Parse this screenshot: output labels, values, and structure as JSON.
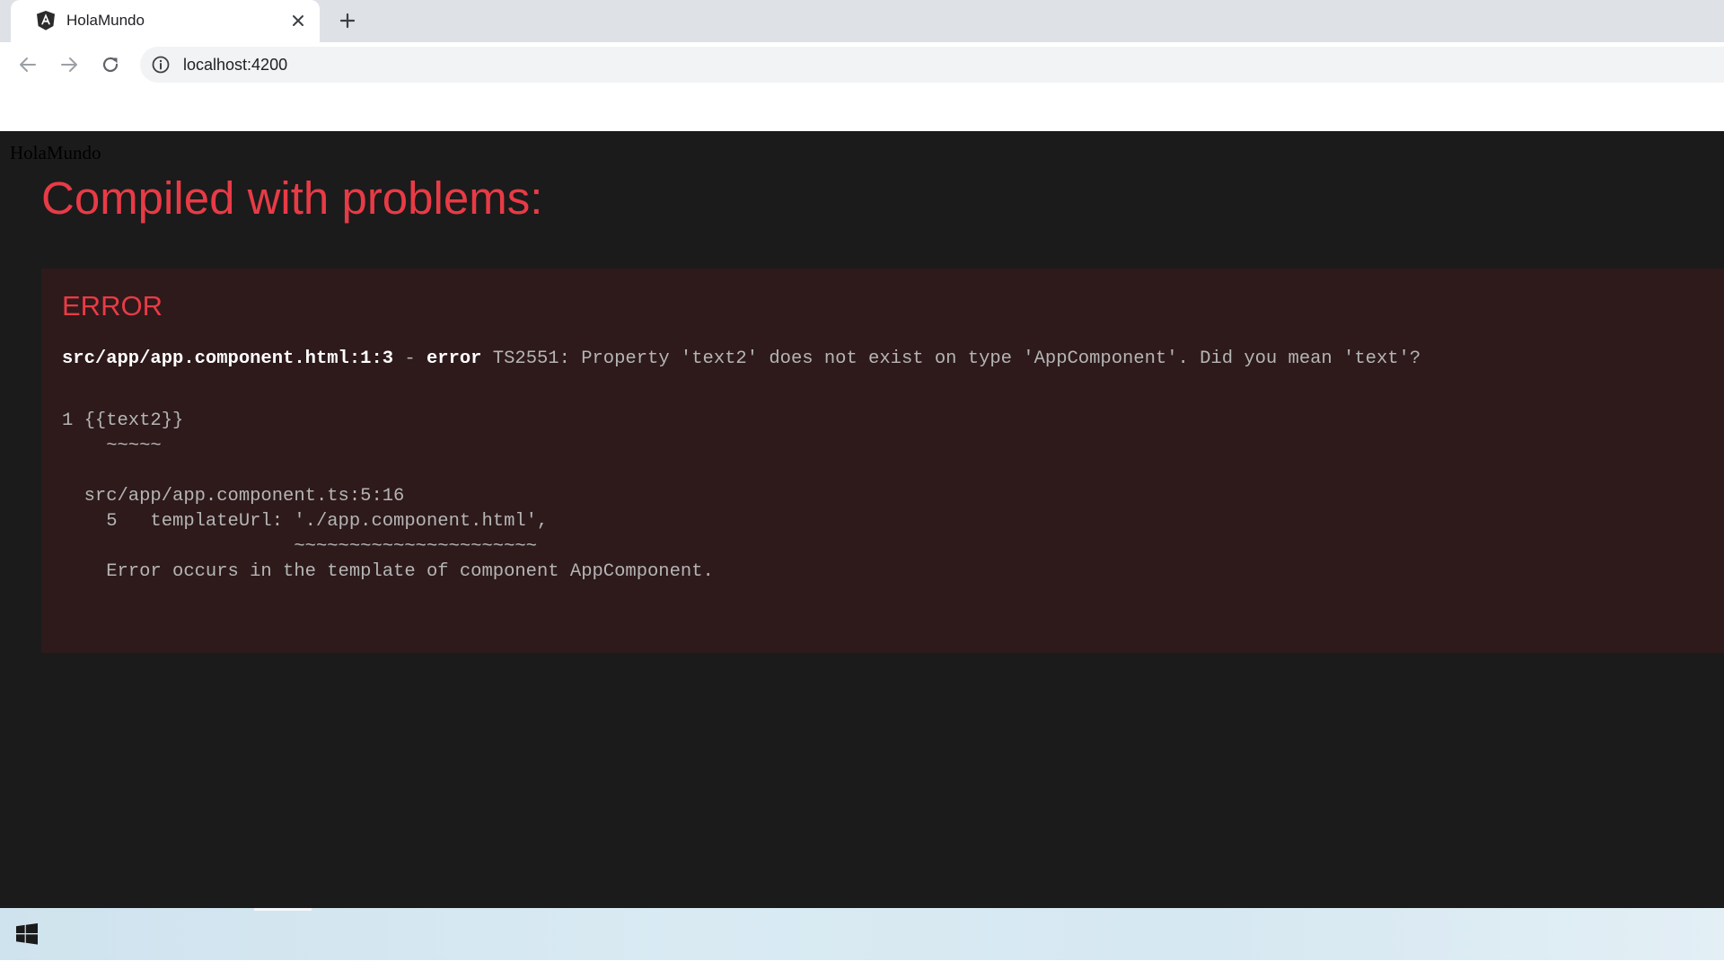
{
  "browser": {
    "tab": {
      "title": "HolaMundo",
      "favicon": "angular-logo-icon"
    },
    "url": "localhost:4200"
  },
  "page": {
    "app_text": "HolaMundo",
    "overlay": {
      "title": "Compiled with problems:",
      "error_header": "ERROR",
      "message": {
        "file": "src/app/app.component.html:1:3",
        "separator": " - ",
        "level": "error",
        "detail": " TS2551: Property 'text2' does not exist on type 'AppComponent'. Did you mean 'text'?"
      },
      "code_lines": [
        "1 {{text2}}",
        "    ~~~~~",
        "  src/app/app.component.ts:5:16",
        "    5   templateUrl: './app.component.html',",
        "                     ~~~~~~~~~~~~~~~~~~~~~~",
        "    Error occurs in the template of component AppComponent."
      ]
    }
  },
  "colors": {
    "overlay_background": "#1b1b1b",
    "error_box_background": "#2e1a1b",
    "error_red": "#e83b46"
  }
}
